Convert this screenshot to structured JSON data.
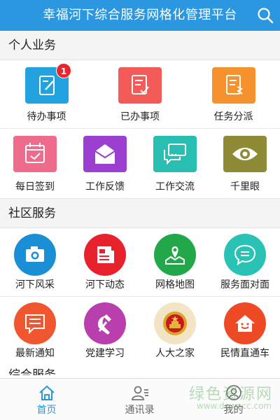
{
  "header": {
    "title": "幸福河下综合服务网格化管理平台",
    "search_icon": "search-icon"
  },
  "colors": {
    "header_bg": "#2b97e0",
    "badge": "#e8262d",
    "active_tab": "#2b97e0"
  },
  "sections": {
    "personal": {
      "title": "个人业务",
      "row1": [
        {
          "label": "待办事项",
          "icon": "edit-note-icon",
          "color": "#22a3e0",
          "badge": "1"
        },
        {
          "label": "已办事项",
          "icon": "checked-list-icon",
          "color": "#f25b57"
        },
        {
          "label": "任务分派",
          "icon": "task-dispatch-icon",
          "color": "#f5922e"
        }
      ],
      "row2": [
        {
          "label": "每日签到",
          "icon": "calendar-check-icon",
          "color": "#ee6b8c"
        },
        {
          "label": "工作反馈",
          "icon": "envelope-open-icon",
          "color": "#9b3fd1"
        },
        {
          "label": "工作交流",
          "icon": "chat-bubbles-icon",
          "color": "#28bfb2"
        },
        {
          "label": "千里眼",
          "icon": "eye-icon",
          "color": "#8f8a36"
        }
      ]
    },
    "community": {
      "title": "社区服务",
      "row1": [
        {
          "label": "河下风采",
          "icon": "camera-icon",
          "color": "#1a8fd6"
        },
        {
          "label": "河下动态",
          "icon": "news-icon",
          "color": "#e8222c"
        },
        {
          "label": "网格地图",
          "icon": "map-pin-icon",
          "color": "#22a84a"
        },
        {
          "label": "服务面对面",
          "icon": "chat-bubble-icon",
          "color": "#29c2b5"
        }
      ],
      "row2": [
        {
          "label": "最新通知",
          "icon": "notice-icon",
          "color": "#f0562f"
        },
        {
          "label": "党建学习",
          "icon": "hammer-sickle-icon",
          "color": "#b93faf"
        },
        {
          "label": "人大之家",
          "icon": "national-emblem-icon",
          "color": "#f3e4c6"
        },
        {
          "label": "民情直通车",
          "icon": "smile-house-icon",
          "color": "#ef4a26"
        }
      ]
    },
    "partial_title": "综合服务"
  },
  "tabbar": {
    "tabs": [
      {
        "label": "首页",
        "icon": "home-icon",
        "active": true
      },
      {
        "label": "通讯录",
        "icon": "contacts-icon",
        "active": false
      },
      {
        "label": "我的",
        "icon": "user-icon",
        "active": false
      }
    ]
  },
  "watermark": {
    "main": "绿色资源网",
    "sub": "www.downcc.com"
  }
}
